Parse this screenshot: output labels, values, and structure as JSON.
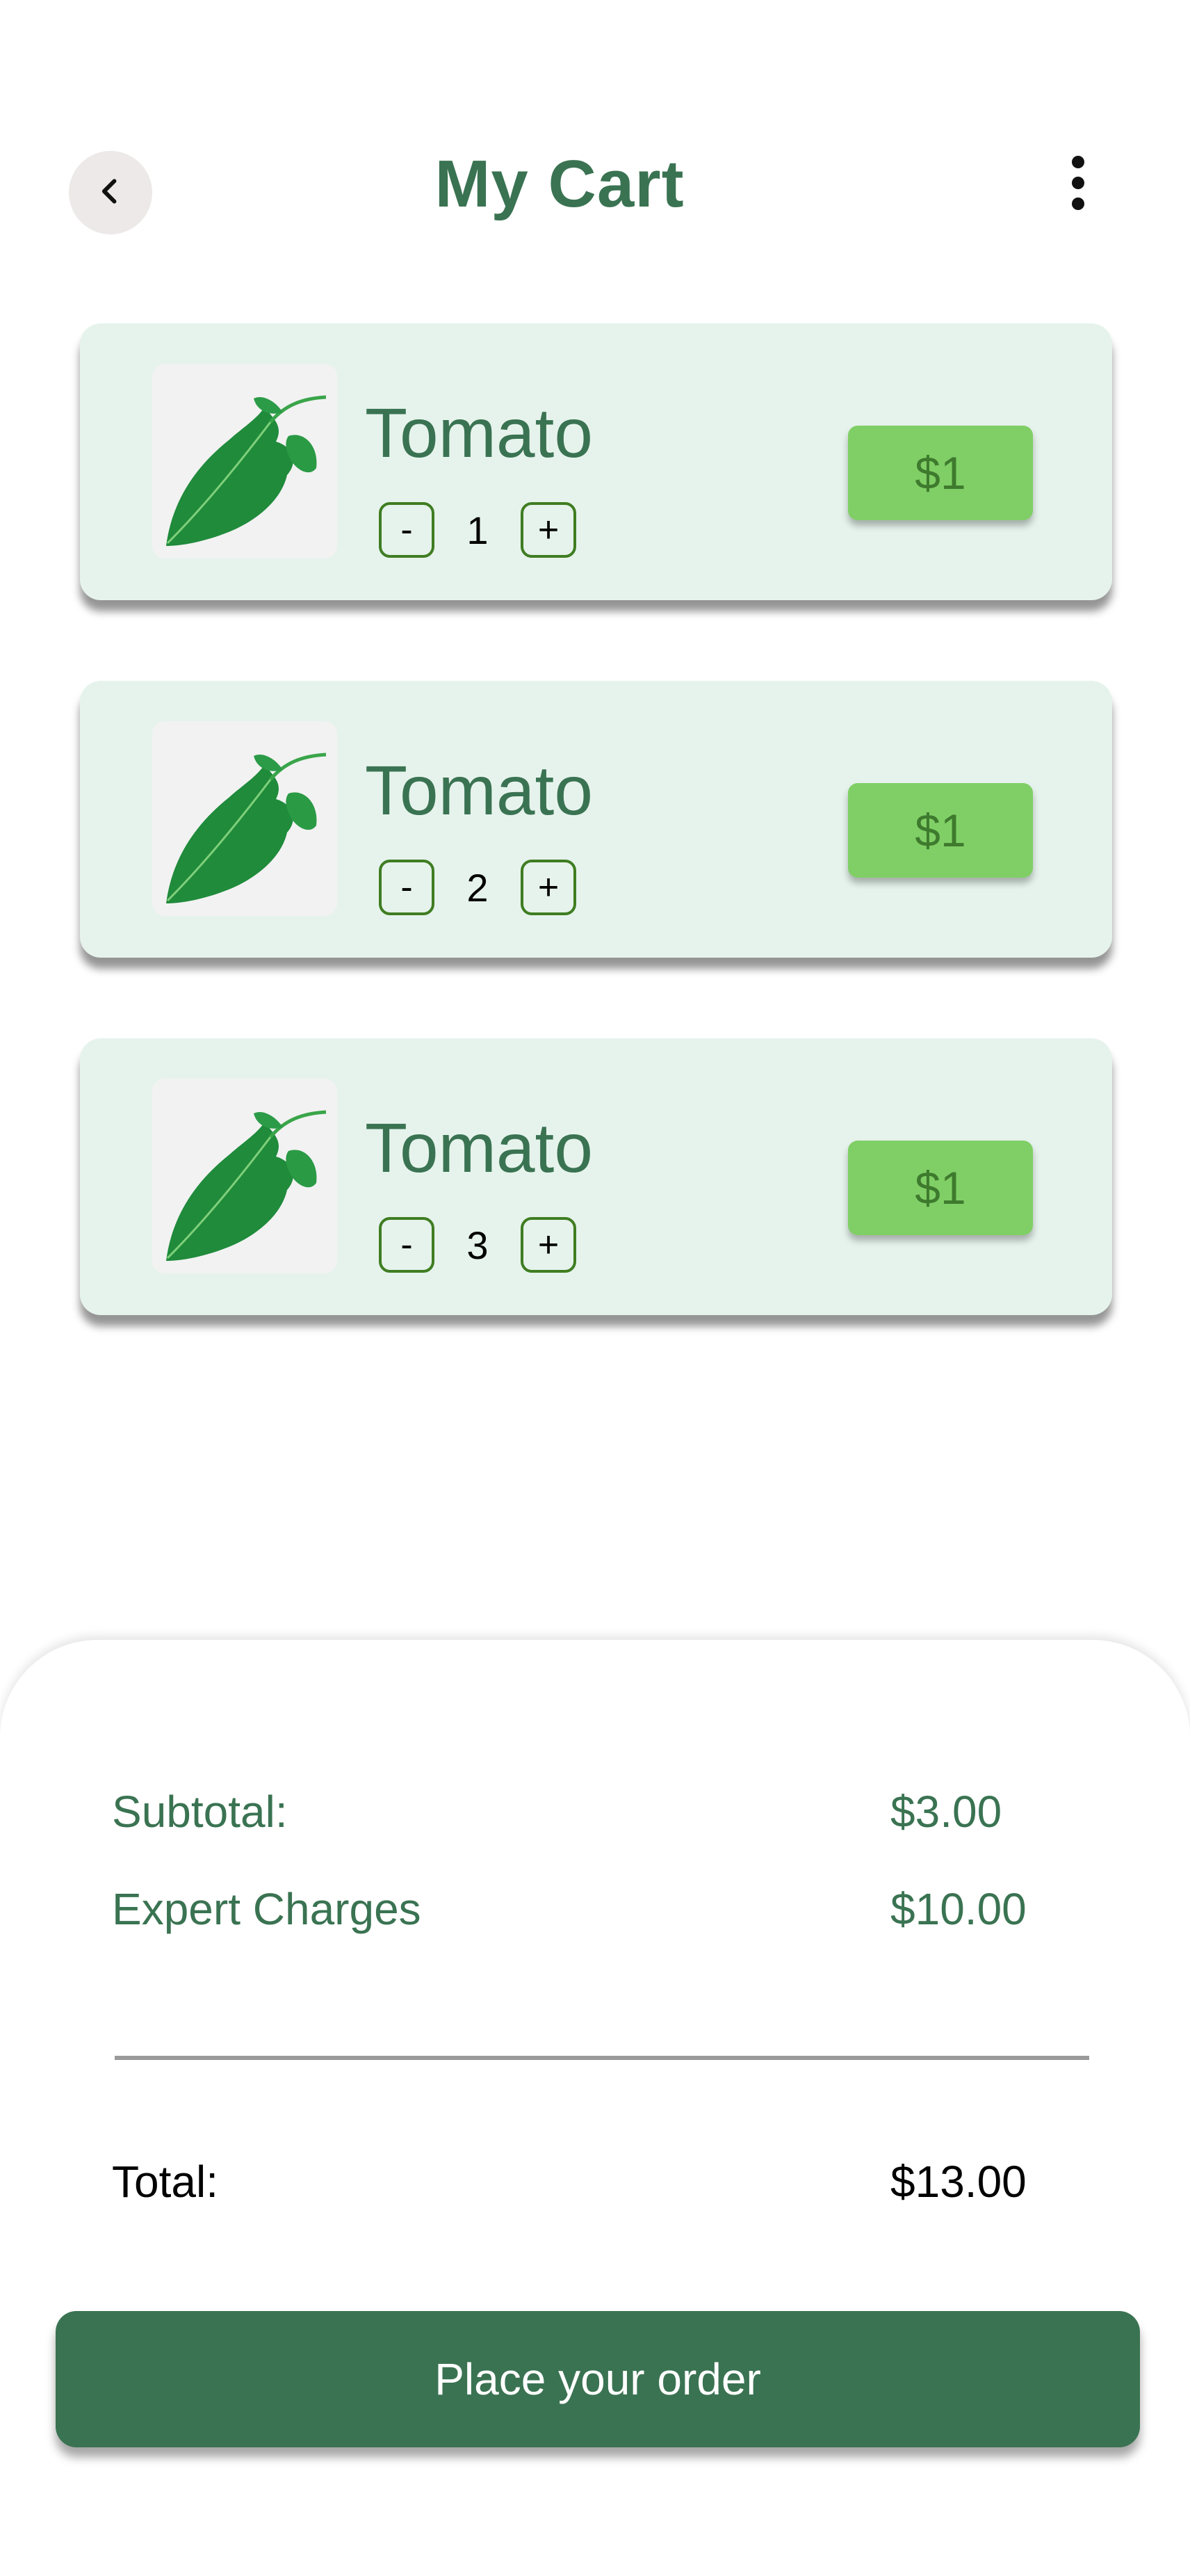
{
  "header": {
    "title": "My Cart",
    "back_icon": "chevron-left-icon",
    "menu_icon": "more-vertical-icon"
  },
  "cart": {
    "items": [
      {
        "name": "Tomato",
        "quantity": "1",
        "price": "$1",
        "decrement_label": "-",
        "increment_label": "+"
      },
      {
        "name": "Tomato",
        "quantity": "2",
        "price": "$1",
        "decrement_label": "-",
        "increment_label": "+"
      },
      {
        "name": "Tomato",
        "quantity": "3",
        "price": "$1",
        "decrement_label": "-",
        "increment_label": "+"
      }
    ]
  },
  "summary": {
    "subtotal_label": "Subtotal:",
    "subtotal_value": "$3.00",
    "charges_label": "Expert Charges",
    "charges_value": "$10.00",
    "total_label": "Total:",
    "total_value": "$13.00",
    "order_button": "Place your order"
  },
  "colors": {
    "primary": "#3a7352",
    "card_background": "#e6f3ec",
    "price_badge": "#80cf66",
    "back_button_bg": "#ece9e8"
  }
}
